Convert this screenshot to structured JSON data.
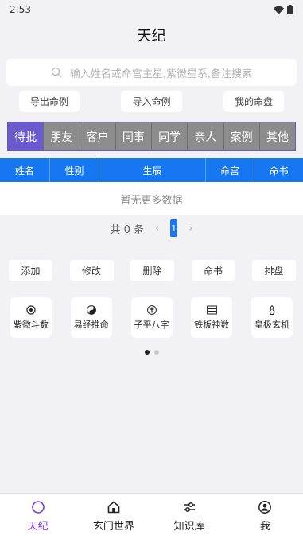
{
  "status": {
    "time": "2:53"
  },
  "header": {
    "title": "天纪"
  },
  "search": {
    "placeholder": "输入姓名或命宫主星,紫微星系,备注搜索"
  },
  "actions": [
    "导出命例",
    "导入命例",
    "我的命盘"
  ],
  "tabs": [
    {
      "label": "待批",
      "active": true
    },
    {
      "label": "朋友",
      "active": false
    },
    {
      "label": "客户",
      "active": false
    },
    {
      "label": "同事",
      "active": false
    },
    {
      "label": "同学",
      "active": false
    },
    {
      "label": "亲人",
      "active": false
    },
    {
      "label": "案例",
      "active": false
    },
    {
      "label": "其他",
      "active": false
    }
  ],
  "table": {
    "columns": [
      "姓名",
      "性别",
      "生辰",
      "命宫",
      "命书"
    ],
    "empty_text": "暂无更多数据"
  },
  "pager": {
    "total_text": "共 0 条",
    "current_page": "1"
  },
  "buttons": [
    "添加",
    "修改",
    "删除",
    "命书",
    "排盘"
  ],
  "tools": [
    {
      "label": "紫微斗数",
      "icon": "ziwei-icon"
    },
    {
      "label": "易经推命",
      "icon": "yinyang-icon"
    },
    {
      "label": "子平八字",
      "icon": "bazi-icon"
    },
    {
      "label": "铁板神数",
      "icon": "abacus-icon"
    },
    {
      "label": "皇极玄机",
      "icon": "huangji-icon"
    }
  ],
  "nav": [
    {
      "label": "天纪",
      "icon": "circle-icon",
      "active": true
    },
    {
      "label": "玄门世界",
      "icon": "home-icon",
      "active": false
    },
    {
      "label": "知识库",
      "icon": "settings-sliders-icon",
      "active": false
    },
    {
      "label": "我",
      "icon": "user-icon",
      "active": false
    }
  ],
  "colors": {
    "accent": "#6b5acd",
    "table_header": "#1677f0",
    "nav_active": "#7c3aed",
    "tab_inactive": "#8c8c8c"
  }
}
